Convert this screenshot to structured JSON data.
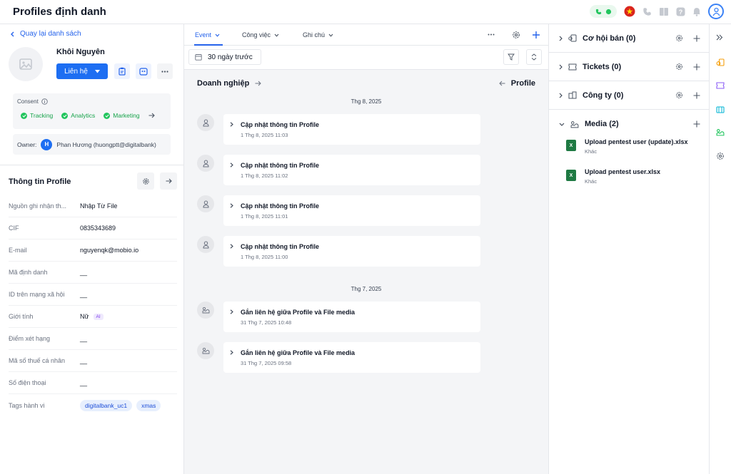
{
  "app": {
    "title": "Profiles định danh"
  },
  "colors": {
    "accent": "#1d6ef2",
    "consent_green": "#22c55e",
    "excel_green": "#1f7a43"
  },
  "left": {
    "back_label": "Quay lại danh sách",
    "name": "Khôi Nguyên",
    "contact_button": "Liên hệ",
    "consent_label": "Consent",
    "consents": [
      "Tracking",
      "Analytics",
      "Marketing"
    ],
    "owner_label": "Owner:",
    "owner_initial": "H",
    "owner_name": "Phan Hương (huongptt@digitalbank)",
    "section_title": "Thông tin Profile",
    "fields": [
      {
        "label": "Nguồn ghi nhận th...",
        "value": "Nhập Từ File"
      },
      {
        "label": "CIF",
        "value": "0835343689"
      },
      {
        "label": "E-mail",
        "value": "nguyenqk@mobio.io"
      },
      {
        "label": "Mã định danh",
        "value": "__"
      },
      {
        "label": "ID trên mạng xã hội",
        "value": "__"
      },
      {
        "label": "Giới tính",
        "value": "Nữ",
        "badge": "AI"
      },
      {
        "label": "Điểm xét hạng",
        "value": "__"
      },
      {
        "label": "Mã số thuế cá nhân",
        "value": "__"
      },
      {
        "label": "Số điện thoại",
        "value": "__"
      }
    ],
    "tags_label": "Tags hành vi",
    "tags": [
      "digitalbank_uc1",
      "xmas"
    ]
  },
  "middle": {
    "tabs": [
      {
        "label": "Event",
        "active": true
      },
      {
        "label": "Công việc",
        "active": false
      },
      {
        "label": "Ghi chú",
        "active": false
      }
    ],
    "date_filter": "30 ngày trước",
    "biz_title": "Doanh nghiệp",
    "profile_link": "Profile",
    "groups": [
      {
        "date": "Thg 8, 2025",
        "events": [
          {
            "title": "Cập nhật thông tin Profile",
            "time": "1 Thg 8, 2025 11:03",
            "icon": "user-icon"
          },
          {
            "title": "Cập nhật thông tin Profile",
            "time": "1 Thg 8, 2025 11:02",
            "icon": "user-icon"
          },
          {
            "title": "Cập nhật thông tin Profile",
            "time": "1 Thg 8, 2025 11:01",
            "icon": "user-icon"
          },
          {
            "title": "Cập nhật thông tin Profile",
            "time": "1 Thg 8, 2025 11:00",
            "icon": "user-icon"
          }
        ]
      },
      {
        "date": "Thg 7, 2025",
        "events": [
          {
            "title": "Gắn liên hệ giữa Profile và File media",
            "time": "31 Thg 7, 2025 10:48",
            "icon": "media-icon"
          },
          {
            "title": "Gắn liên hệ giữa Profile và File media",
            "time": "31 Thg 7, 2025 09:58",
            "icon": "media-icon"
          }
        ]
      }
    ]
  },
  "right": {
    "sections": [
      {
        "label": "Cơ hội bán (0)",
        "icon": "deal-icon",
        "settings": true
      },
      {
        "label": "Tickets (0)",
        "icon": "ticket-icon",
        "settings": true
      },
      {
        "label": "Công ty (0)",
        "icon": "company-icon",
        "settings": true
      },
      {
        "label": "Media (2)",
        "icon": "media-icon",
        "settings": false
      }
    ],
    "media": [
      {
        "name": "Upload pentest user (update).xlsx",
        "sub": "Khác"
      },
      {
        "name": "Upload pentest user.xlsx",
        "sub": "Khác"
      }
    ]
  }
}
